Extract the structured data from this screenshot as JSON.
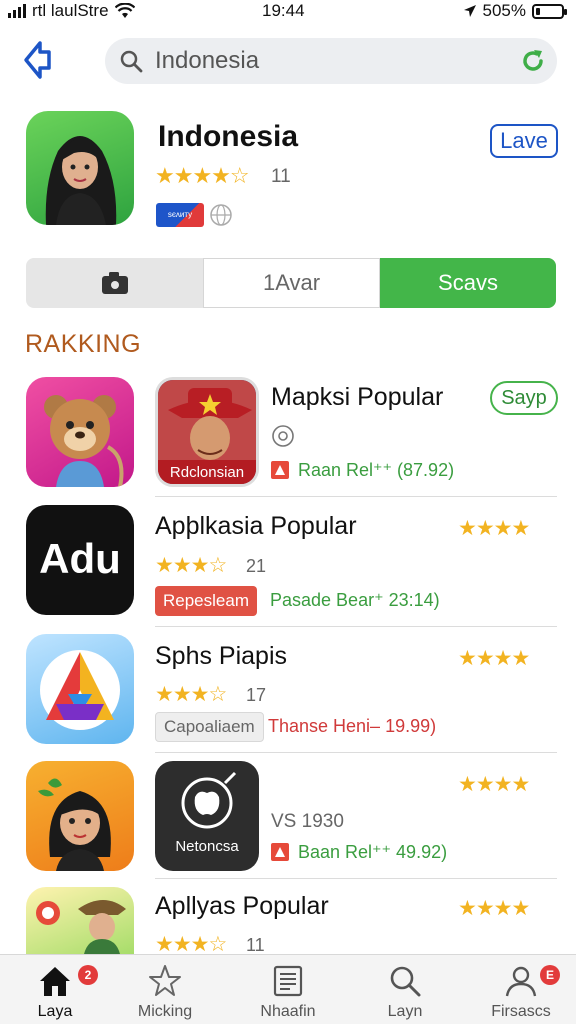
{
  "status_bar": {
    "carrier": "rtl laulStre",
    "time": "19:44",
    "battery": "505%"
  },
  "search": {
    "value": "Indonesia"
  },
  "featured": {
    "title": "Indonesia",
    "rating_count": "11",
    "flag_text": "ѕєᴧиту",
    "action_label": "Lave",
    "stars": "★★★★☆"
  },
  "segments": [
    {
      "label": "",
      "icon": "camera-icon"
    },
    {
      "label": "1Avar"
    },
    {
      "label": "Scavs"
    }
  ],
  "section_title": "RAKKING",
  "apps": [
    {
      "title": "Mapksi Popular",
      "sub_icon_label": "Rdclonsian",
      "price": "Raan Rel⁺⁺ (87.92)",
      "action_label": "Sayp",
      "price_color": "#3a9d3f"
    },
    {
      "title": "Apþlkasia Popular",
      "icon_text": "Adu",
      "stars": "★★★☆",
      "right_stars": "★★★★",
      "count": "21",
      "tag": "Repesleam",
      "price": "Pasade Bear⁺ 23:14)",
      "price_color": "#3a9d3f"
    },
    {
      "title": "Sphs Piapis",
      "stars": "★★★☆",
      "right_stars": "★★★★",
      "count": "17",
      "tag": "Capoaliaem",
      "price": "Thanse Heni–  19.99)",
      "price_color": "#d03a3a"
    },
    {
      "title": "",
      "sub_icon_label": "Netoncsa",
      "right_stars": "★★★★",
      "version": "VS 1930",
      "price": "Baan Rel⁺⁺ 49.92)",
      "price_color": "#3a9d3f"
    },
    {
      "title": "Apllyas Popular",
      "stars": "★★★☆",
      "right_stars": "★★★★",
      "count": "11"
    }
  ],
  "tabs": [
    {
      "label": "Laya",
      "badge": "2"
    },
    {
      "label": "Micking"
    },
    {
      "label": "Nhaafin"
    },
    {
      "label": "Layn"
    },
    {
      "label": "Firsascs",
      "badge": "E"
    }
  ],
  "colors": {
    "accent_blue": "#1d55c6",
    "accent_green": "#43b649",
    "star": "#f2b321",
    "section_title": "#b05a1e"
  }
}
